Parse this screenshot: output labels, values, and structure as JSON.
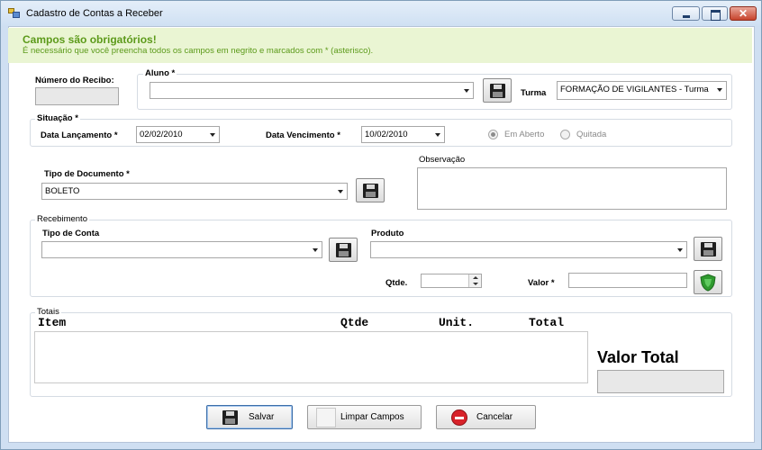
{
  "window": {
    "title": "Cadastro de Contas a Receber"
  },
  "notice": {
    "title": "Campos são obrigatórios!",
    "text": "É necessário que você preencha todos os campos em negrito e marcados com * (asterisco)."
  },
  "header_section": {
    "recibo_label": "Número do Recibo:",
    "recibo_value": "",
    "aluno_legend": "Aluno *",
    "aluno_value": "",
    "turma_label": "Turma",
    "turma_value": "FORMAÇÃO DE VIGILANTES - Turma"
  },
  "situacao": {
    "legend": "Situação *",
    "data_lancamento_label": "Data Lançamento *",
    "data_lancamento_value": "02/02/2010",
    "data_vencimento_label": "Data Vencimento *",
    "data_vencimento_value": "10/02/2010",
    "radio_em_aberto": "Em Aberto",
    "radio_quitada": "Quitada",
    "selected": "Em Aberto"
  },
  "documento": {
    "label": "Tipo de Documento *",
    "value": "BOLETO",
    "observacao_label": "Observação",
    "observacao_value": ""
  },
  "recebimento": {
    "legend": "Recebimento",
    "tipo_conta_label": "Tipo de Conta",
    "tipo_conta_value": "",
    "produto_label": "Produto",
    "produto_value": "",
    "qtde_label": "Qtde.",
    "qtde_value": "",
    "valor_label": "Valor *",
    "valor_value": ""
  },
  "totais": {
    "legend": "Totais",
    "columns": [
      "Item",
      "Qtde",
      "Unit.",
      "Total"
    ],
    "valor_total_label": "Valor Total",
    "valor_total_value": ""
  },
  "actions": {
    "salvar": "Salvar",
    "limpar": "Limpar Campos",
    "cancelar": "Cancelar"
  },
  "colors": {
    "notice_bg": "#eaf5d3",
    "notice_text": "#5c9a1a",
    "shield": "#2f9a2f"
  }
}
